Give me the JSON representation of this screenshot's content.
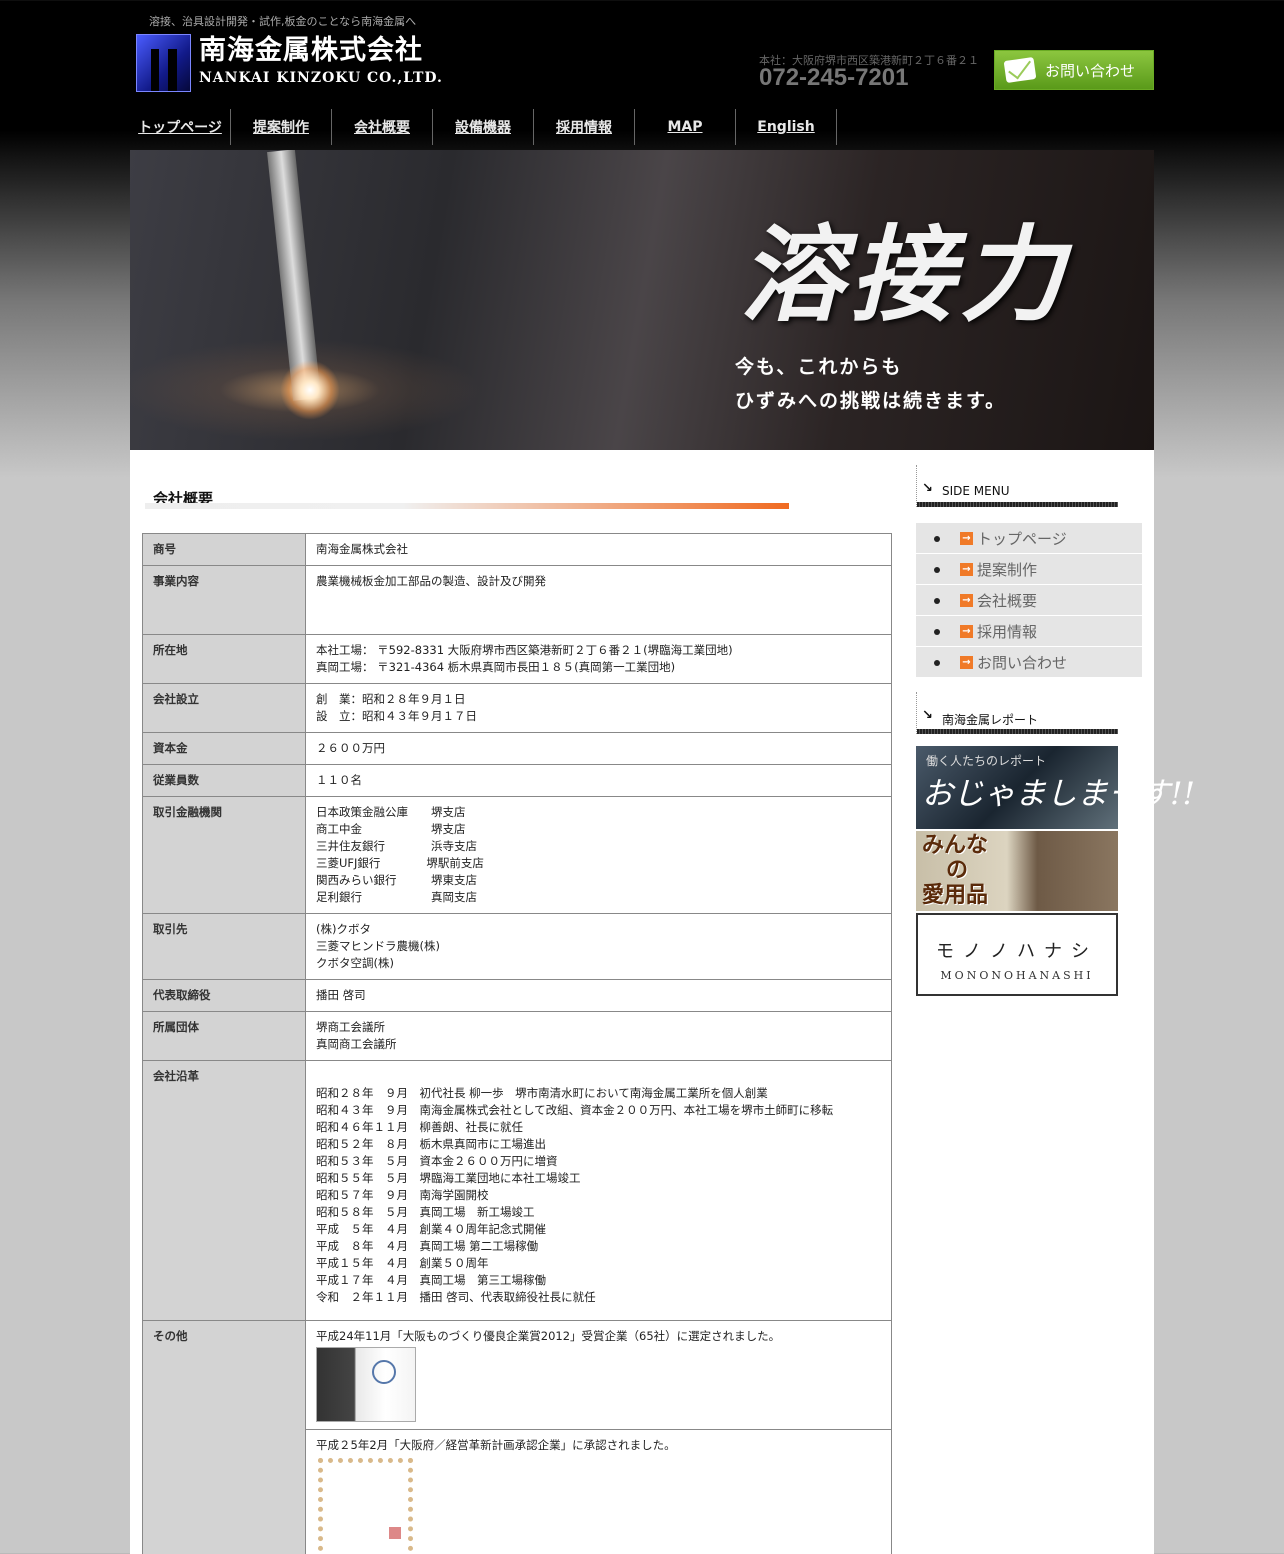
{
  "header": {
    "tagline": "溶接、治具設計開発・試作,板金のことなら南海金属へ",
    "logo_jp": "南海金属株式会社",
    "logo_en": "NANKAI KINZOKU CO.,LTD.",
    "address": "本社：大阪府堺市西区築港新町２丁６番２１",
    "phone": "072-245-7201",
    "contact_label": "お問い合わせ"
  },
  "nav": [
    "トップページ",
    "提案制作",
    "会社概要",
    "設備機器",
    "採用情報",
    "MAP",
    "English"
  ],
  "hero": {
    "title": "溶接力",
    "subtitle_1": "今も、これからも",
    "subtitle_2": "ひずみへの挑戦は続きます。"
  },
  "main": {
    "title": "会社概要",
    "rows": [
      {
        "label": "商号",
        "value": "南海金属株式会社"
      },
      {
        "label": "事業内容",
        "value": "農業機械板金加工部品の製造、設計及び開発"
      },
      {
        "label": "所在地",
        "value": "本社工場： 〒592-8331 大阪府堺市西区築港新町２丁６番２１(堺臨海工業団地)\n真岡工場： 〒321-4364 栃木県真岡市長田１８５(真岡第一工業団地)"
      },
      {
        "label": "会社設立",
        "value": "創　業：昭和２８年９月１日\n設　立：昭和４３年９月１７日"
      },
      {
        "label": "資本金",
        "value": "２６００万円"
      },
      {
        "label": "従業員数",
        "value": "１１０名"
      },
      {
        "label": "取引金融機関",
        "value": "日本政策金融公庫　　堺支店\n商工中金　　　　　　堺支店\n三井住友銀行　　　　浜寺支店\n三菱UFJ銀行　　　　堺駅前支店\n関西みらい銀行　　　堺東支店\n足利銀行　　　　　　真岡支店"
      },
      {
        "label": "取引先",
        "value": "(株)クボタ\n三菱マヒンドラ農機(株)\nクボタ空調(株)"
      },
      {
        "label": "代表取締役",
        "value": "播田 啓司"
      },
      {
        "label": "所属団体",
        "value": "堺商工会議所\n真岡商工会議所"
      },
      {
        "label": "会社沿革",
        "value": "\n昭和２８年　９月　初代社長 柳一歩　堺市南清水町において南海金属工業所を個人創業\n昭和４３年　９月　南海金属株式会社として改組、資本金２００万円、本社工場を堺市土師町に移転\n昭和４６年１１月　柳善朗、社長に就任\n昭和５２年　８月　栃木県真岡市に工場進出\n昭和５３年　５月　資本金２６００万円に増資\n昭和５５年　５月　堺臨海工業団地に本社工場竣工\n昭和５７年　９月　南海学園開校\n昭和５８年　５月　真岡工場　新工場竣工\n平成　５年　４月　創業４０周年記念式開催\n平成　８年　４月　真岡工場 第二工場稼働\n平成１５年　４月　創業５０周年\n平成１７年　４月　真岡工場　第三工場稼働\n令和　２年１１月　播田 啓司、代表取締役社長に就任"
      }
    ],
    "other_label": "その他",
    "other_1": "平成24年11月「大阪ものづくり優良企業賞2012」受賞企業（65社）に選定されました。",
    "other_2": "平成２5年2月「大阪府／経営革新計画承認企業」に承認されました。"
  },
  "side": {
    "menu_title": "SIDE MENU",
    "menu": [
      "トップページ",
      "提案制作",
      "会社概要",
      "採用情報",
      "お問い合わせ"
    ],
    "report_title": "南海金属レポート",
    "banner1_small": "働く人たちのレポート",
    "banner1_big": "おじゃましまーす!!",
    "banner2_l1": "みんな",
    "banner2_l2": "の",
    "banner2_l3": "愛用品",
    "banner3_jp": "モノノハナシ",
    "banner3_en": "MONONOHANASHI"
  }
}
